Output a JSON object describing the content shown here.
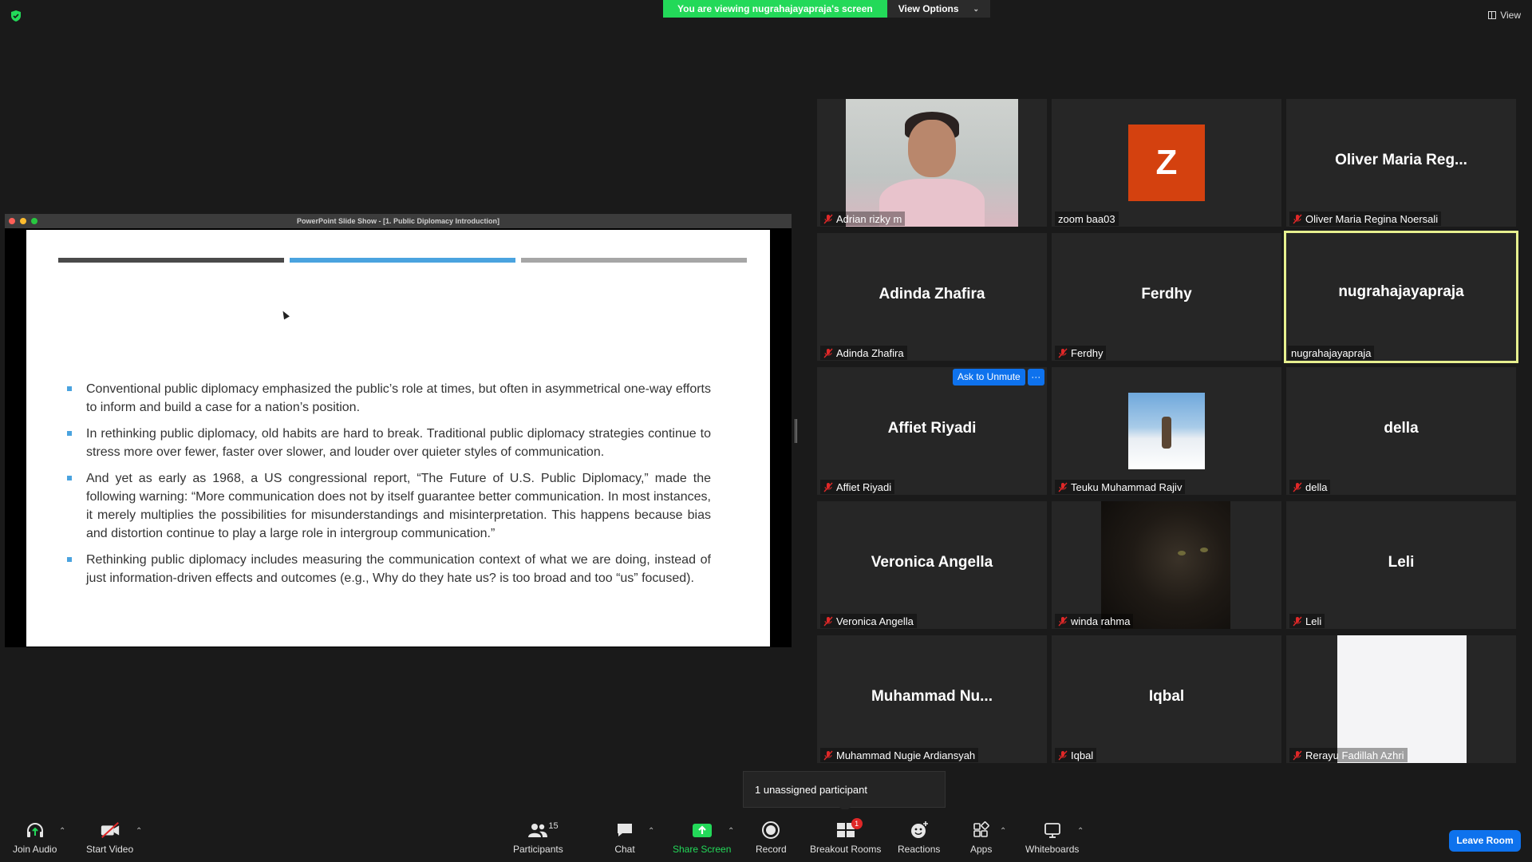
{
  "banner": {
    "viewing_text": "You are viewing nugrahajayapraja's screen",
    "view_options": "View Options"
  },
  "top_right": {
    "view_label": "View"
  },
  "share": {
    "window_title": "PowerPoint Slide Show - [1. Public Diplomacy Introduction]",
    "bar_colors": [
      "#4a4a4a",
      "#4aa3df",
      "#a6a6a6"
    ],
    "bullets": [
      "Conventional public diplomacy emphasized the public’s role at times, but often in asymmetrical one-way efforts to inform and build a case for a nation’s position.",
      "In rethinking public diplomacy, old habits are hard to break. Traditional public diplomacy strategies continue to stress more over fewer, faster over slower, and louder over quieter styles of communication.",
      "And yet as early as 1968, a US congressional report, “The Future of U.S. Public Diplomacy,” made the following warning: “More communication does not by itself guarantee better communication. In most instances, it merely multiplies the possibilities for misunderstandings and misinterpretation. This happens because bias and distortion continue to play a large role in intergroup communication.”",
      "Rethinking public diplomacy includes measuring the communication context of what we are doing, instead of just information-driven effects and outcomes (e.g., Why do they hate us? is too broad and too “us” focused)."
    ]
  },
  "participants": [
    {
      "label": "Adrian rizky m",
      "big": ""
    },
    {
      "label": "zoom baa03",
      "big": "",
      "avatar_letter": "Z"
    },
    {
      "label": "Oliver Maria Regina Noersali",
      "big": "Oliver Maria Reg..."
    },
    {
      "label": "Adinda Zhafira",
      "big": "Adinda Zhafira"
    },
    {
      "label": "Ferdhy",
      "big": "Ferdhy"
    },
    {
      "label": "nugrahajayapraja",
      "big": "nugrahajayapraja"
    },
    {
      "label": "Affiet Riyadi",
      "big": "Affiet Riyadi"
    },
    {
      "label": "Teuku Muhammad Rajiv",
      "big": ""
    },
    {
      "label": "della",
      "big": "della"
    },
    {
      "label": "Veronica Angella",
      "big": "Veronica Angella"
    },
    {
      "label": "winda rahma",
      "big": ""
    },
    {
      "label": "Leli",
      "big": "Leli"
    },
    {
      "label": "Muhammad Nugie Ardiansyah",
      "big": "Muhammad  Nu..."
    },
    {
      "label": "Iqbal",
      "big": "Iqbal"
    },
    {
      "label": "Rerayu Fadillah Azhri",
      "big": ""
    }
  ],
  "ask_unmute": {
    "label": "Ask to Unmute",
    "more": "···"
  },
  "unassigned_popup": "1 unassigned participant",
  "toolbar": {
    "join_audio": "Join Audio",
    "start_video": "Start Video",
    "participants": "Participants",
    "participants_count": "15",
    "chat": "Chat",
    "share_screen": "Share Screen",
    "record": "Record",
    "breakout_rooms": "Breakout Rooms",
    "breakout_badge": "1",
    "reactions": "Reactions",
    "apps": "Apps",
    "whiteboards": "Whiteboards",
    "leave_room": "Leave Room"
  },
  "colors": {
    "share_green": "#23d959",
    "accent_blue": "#0e72ed",
    "active_border": "#e7f08f",
    "mute_red": "#e02828"
  }
}
